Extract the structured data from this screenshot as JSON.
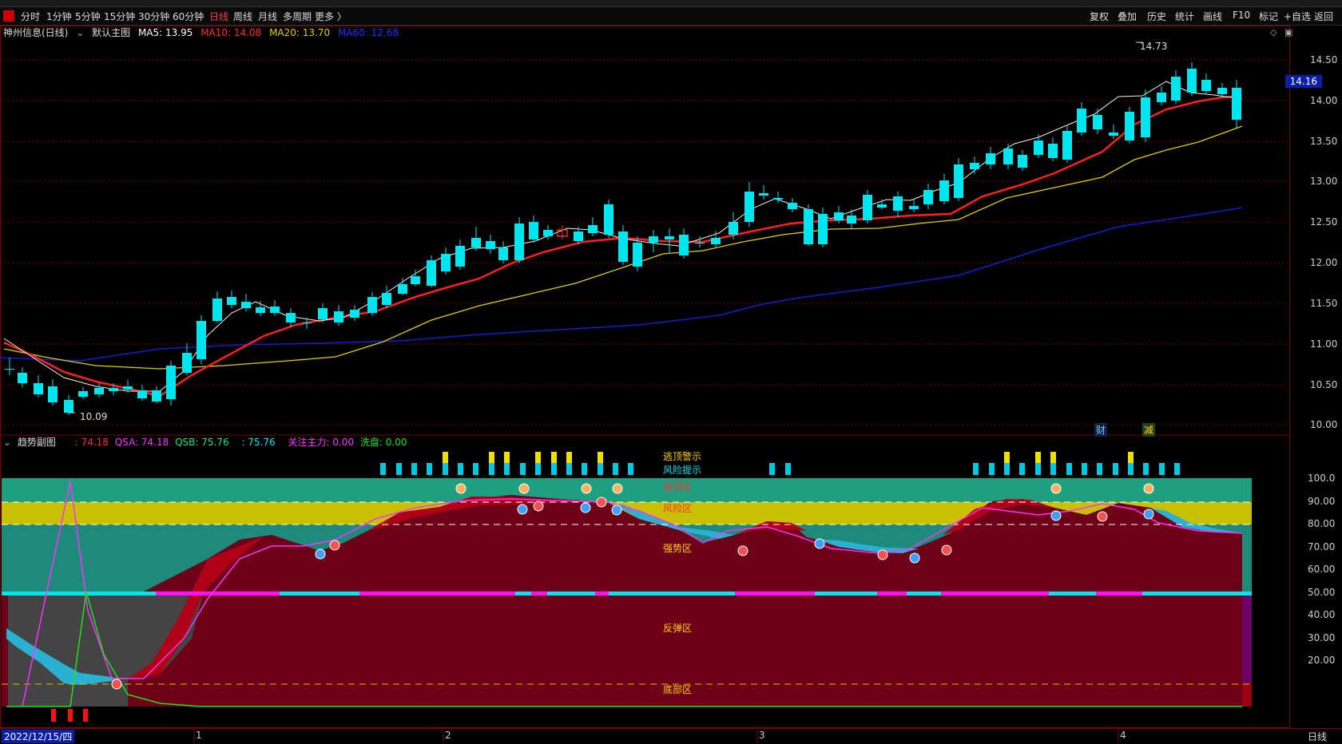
{
  "toolbar": {
    "periods": [
      "分时",
      "1分钟",
      "5分钟",
      "15分钟",
      "30分钟",
      "60分钟",
      "日线",
      "周线",
      "月线",
      "多周期",
      "更多 〉"
    ],
    "active_period": "日线",
    "right_buttons": [
      "复权",
      "叠加",
      "历史",
      "统计",
      "画线",
      "F10",
      "标记",
      "+自选",
      "返回"
    ]
  },
  "main_chart": {
    "stock_title": "神州信息(日线)",
    "template_label": "默认主图",
    "ma5": "MA5: 13.95",
    "ma10": "MA10: 14.08",
    "ma20": "MA20: 13.70",
    "ma60": "MA60: 12.68",
    "high_label": "14.73",
    "low_label": "10.09",
    "current_price": "14.16",
    "y_ticks": [
      "14.50",
      "14.00",
      "13.50",
      "13.00",
      "12.50",
      "12.00",
      "11.50",
      "11.00",
      "10.50",
      "10.00"
    ],
    "badges": [
      "财",
      "减"
    ]
  },
  "sub_chart": {
    "title": "趋势副图",
    "v1": ": 74.18",
    "qsa": "QSA: 74.18",
    "qsb": "QSB: 75.76",
    "v2": ": 75.76",
    "gzzl": "关注主力: 0.00",
    "xp": "洗盘: 0.00",
    "y_ticks": [
      "100.0",
      "90.00",
      "80.00",
      "70.00",
      "60.00",
      "50.00",
      "40.00",
      "30.00",
      "20.00"
    ],
    "zones": {
      "escape_warning": "逃顶警示",
      "risk_hint": "风险提示",
      "escape_zone": "逃顶区",
      "risk_zone": "风险区",
      "strong_zone": "强势区",
      "rebound_zone": "反弹区",
      "bottom_zone": "底部区"
    }
  },
  "date_axis": {
    "start_date": "2022/12/15/四",
    "months": [
      "1",
      "2",
      "3",
      "4"
    ],
    "period_label": "日线"
  },
  "colors": {
    "up": "#ff3333",
    "down": "#00e5ee",
    "ma5": "#ffffff",
    "ma10": "#ff2020",
    "ma20": "#e0d000",
    "ma60": "#1020d0"
  }
}
